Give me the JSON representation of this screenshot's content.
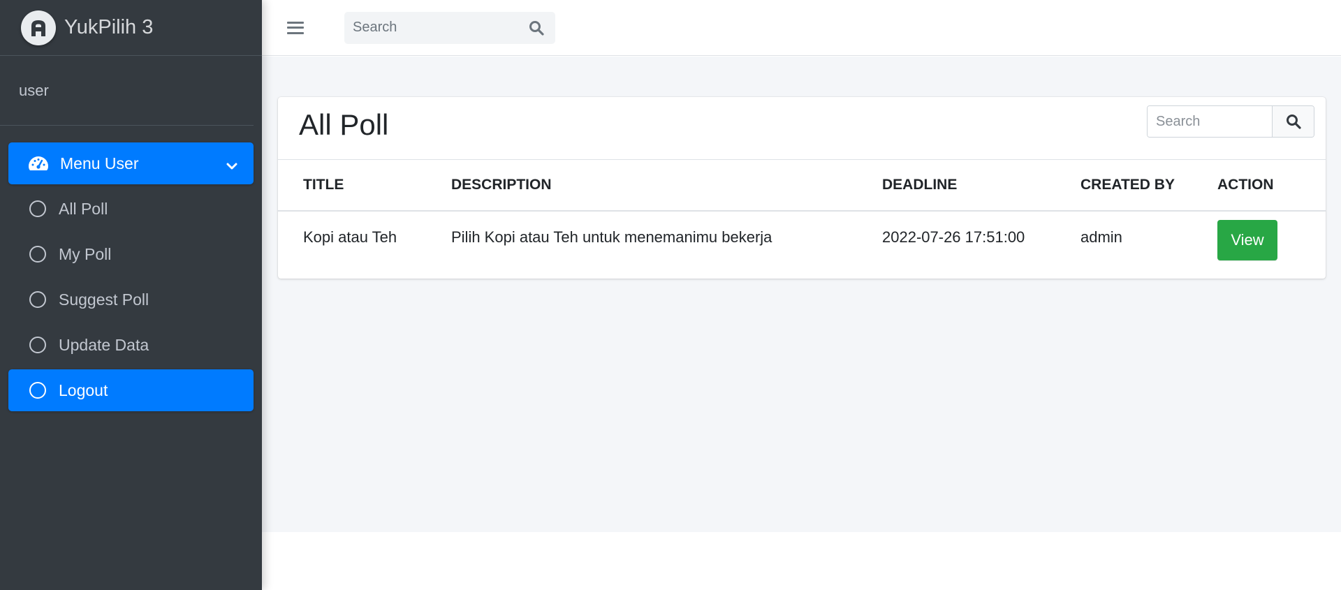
{
  "brand": {
    "name": "YukPilih 3"
  },
  "user": {
    "name": "user"
  },
  "sidebar": {
    "items": [
      {
        "label": "Menu User"
      },
      {
        "label": "All Poll"
      },
      {
        "label": "My Poll"
      },
      {
        "label": "Suggest Poll"
      },
      {
        "label": "Update Data"
      },
      {
        "label": "Logout"
      }
    ]
  },
  "topbar": {
    "search_placeholder": "Search"
  },
  "main": {
    "title": "All Poll",
    "search_placeholder": "Search",
    "table": {
      "headers": [
        "TITLE",
        "DESCRIPTION",
        "DEADLINE",
        "CREATED BY",
        "ACTION"
      ],
      "rows": [
        {
          "title": "Kopi atau Teh",
          "description": "Pilih Kopi atau Teh untuk menemanimu bekerja",
          "deadline": "2022-07-26 17:51:00",
          "created_by": "admin",
          "action": "View"
        }
      ]
    }
  },
  "colors": {
    "sidebar_bg": "#343a40",
    "primary": "#007bff",
    "success": "#28a745",
    "content_bg": "#f4f6f9"
  }
}
